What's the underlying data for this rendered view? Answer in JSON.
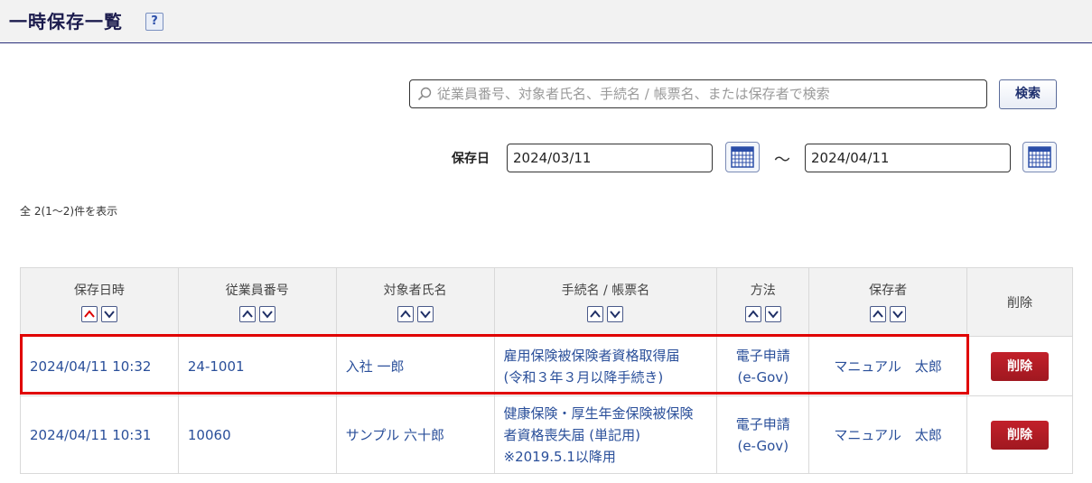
{
  "header": {
    "title": "一時保存一覧",
    "help": "?"
  },
  "search": {
    "placeholder": "従業員番号、対象者氏名、手続名 / 帳票名、または保存者で検索",
    "button": "検索"
  },
  "date_filter": {
    "label": "保存日",
    "from": "2024/03/11",
    "separator": "～",
    "to": "2024/04/11"
  },
  "count_text": "全 2(1～2)件を表示",
  "table": {
    "columns": [
      "保存日時",
      "従業員番号",
      "対象者氏名",
      "手続名 / 帳票名",
      "方法",
      "保存者",
      "削除"
    ],
    "rows": [
      {
        "saved_at": "2024/04/11 10:32",
        "employee_no": "24-1001",
        "target_name": "入社 一郎",
        "procedure_lines": [
          "雇用保険被保険者資格取得届",
          "(令和３年３月以降手続き)"
        ],
        "method_lines": [
          "電子申請",
          "(e-Gov)"
        ],
        "saver": "マニュアル　太郎",
        "delete": "削除"
      },
      {
        "saved_at": "2024/04/11 10:31",
        "employee_no": "10060",
        "target_name": "サンプル 六十郎",
        "procedure_lines": [
          "健康保険・厚生年金保険被保険",
          "者資格喪失届 (単記用)",
          "※2019.5.1以降用"
        ],
        "method_lines": [
          "電子申請",
          "(e-Gov)"
        ],
        "saver": "マニュアル　太郎",
        "delete": "削除"
      }
    ]
  },
  "colors": {
    "link": "#2a4f9a",
    "delete": "#b01c24",
    "highlight": "#e00000",
    "title": "#1b1b4d"
  }
}
